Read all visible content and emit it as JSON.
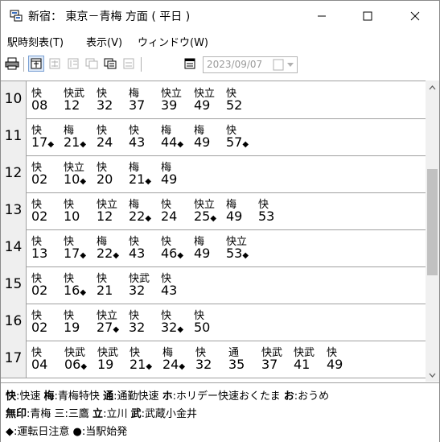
{
  "window": {
    "title": "新宿： 東京－青梅 方面 ( 平日 )"
  },
  "menu": [
    {
      "label": "駅時刻表(T)"
    },
    {
      "label": "表示(V)"
    },
    {
      "label": "ウィンドウ(W)"
    }
  ],
  "toolbar": {
    "date": "2023/09/07",
    "icons": [
      "print-icon",
      "timetable-icon",
      "train-icon",
      "line-icon",
      "weekday-icon",
      "station-icon",
      "holiday-icon",
      "calendar-icon",
      "date-dropdown-icon"
    ]
  },
  "timetable": [
    {
      "hour": "10",
      "entries": [
        {
          "type": "快",
          "min": "08",
          "mark": ""
        },
        {
          "type": "快武",
          "min": "12",
          "mark": ""
        },
        {
          "type": "快",
          "min": "32",
          "mark": ""
        },
        {
          "type": "梅",
          "min": "37",
          "mark": ""
        },
        {
          "type": "快立",
          "min": "39",
          "mark": ""
        },
        {
          "type": "快立",
          "min": "49",
          "mark": ""
        },
        {
          "type": "快",
          "min": "52",
          "mark": ""
        }
      ]
    },
    {
      "hour": "11",
      "entries": [
        {
          "type": "快",
          "min": "17",
          "mark": "◆"
        },
        {
          "type": "梅",
          "min": "21",
          "mark": "◆"
        },
        {
          "type": "快",
          "min": "24",
          "mark": ""
        },
        {
          "type": "快",
          "min": "43",
          "mark": ""
        },
        {
          "type": "梅",
          "min": "44",
          "mark": "◆"
        },
        {
          "type": "梅",
          "min": "49",
          "mark": ""
        },
        {
          "type": "快",
          "min": "57",
          "mark": "◆"
        }
      ]
    },
    {
      "hour": "12",
      "entries": [
        {
          "type": "快",
          "min": "02",
          "mark": ""
        },
        {
          "type": "快立",
          "min": "10",
          "mark": "◆"
        },
        {
          "type": "快",
          "min": "20",
          "mark": ""
        },
        {
          "type": "梅",
          "min": "21",
          "mark": "◆"
        },
        {
          "type": "梅",
          "min": "49",
          "mark": ""
        }
      ]
    },
    {
      "hour": "13",
      "entries": [
        {
          "type": "快",
          "min": "02",
          "mark": ""
        },
        {
          "type": "快",
          "min": "10",
          "mark": ""
        },
        {
          "type": "快立",
          "min": "12",
          "mark": ""
        },
        {
          "type": "梅",
          "min": "22",
          "mark": "◆"
        },
        {
          "type": "快",
          "min": "24",
          "mark": ""
        },
        {
          "type": "快立",
          "min": "25",
          "mark": "◆"
        },
        {
          "type": "梅",
          "min": "49",
          "mark": ""
        },
        {
          "type": "快",
          "min": "53",
          "mark": ""
        }
      ]
    },
    {
      "hour": "14",
      "entries": [
        {
          "type": "快",
          "min": "13",
          "mark": ""
        },
        {
          "type": "快",
          "min": "17",
          "mark": "◆"
        },
        {
          "type": "梅",
          "min": "22",
          "mark": "◆"
        },
        {
          "type": "快",
          "min": "43",
          "mark": ""
        },
        {
          "type": "快",
          "min": "46",
          "mark": "◆"
        },
        {
          "type": "梅",
          "min": "49",
          "mark": ""
        },
        {
          "type": "快立",
          "min": "53",
          "mark": "◆"
        }
      ]
    },
    {
      "hour": "15",
      "entries": [
        {
          "type": "快",
          "min": "02",
          "mark": ""
        },
        {
          "type": "快",
          "min": "16",
          "mark": "◆"
        },
        {
          "type": "快",
          "min": "21",
          "mark": ""
        },
        {
          "type": "快武",
          "min": "32",
          "mark": ""
        },
        {
          "type": "快",
          "min": "43",
          "mark": ""
        }
      ]
    },
    {
      "hour": "16",
      "entries": [
        {
          "type": "快",
          "min": "02",
          "mark": ""
        },
        {
          "type": "快",
          "min": "19",
          "mark": ""
        },
        {
          "type": "快立",
          "min": "27",
          "mark": "◆"
        },
        {
          "type": "快",
          "min": "32",
          "mark": ""
        },
        {
          "type": "快",
          "min": "32",
          "mark": "◆"
        },
        {
          "type": "快",
          "min": "50",
          "mark": ""
        }
      ]
    },
    {
      "hour": "17",
      "entries": [
        {
          "type": "快",
          "min": "04",
          "mark": ""
        },
        {
          "type": "快武",
          "min": "06",
          "mark": "◆"
        },
        {
          "type": "快武",
          "min": "19",
          "mark": ""
        },
        {
          "type": "快",
          "min": "21",
          "mark": "◆"
        },
        {
          "type": "梅",
          "min": "24",
          "mark": "◆"
        },
        {
          "type": "快",
          "min": "32",
          "mark": ""
        },
        {
          "type": "通",
          "min": "35",
          "mark": ""
        },
        {
          "type": "快武",
          "min": "37",
          "mark": ""
        },
        {
          "type": "快武",
          "min": "41",
          "mark": ""
        },
        {
          "type": "快",
          "min": "49",
          "mark": ""
        }
      ]
    }
  ],
  "legend": {
    "line1": [
      {
        "key": "快",
        "text": ":快速 "
      },
      {
        "key": "梅",
        "text": ":青梅特快 "
      },
      {
        "key": "通",
        "text": ":通勤快速 "
      },
      {
        "key": "ホ",
        "text": ":ホリデー快速おくたま "
      },
      {
        "key": "お",
        "text": ":おうめ"
      }
    ],
    "line2": [
      {
        "key": "無印",
        "text": ":青梅 三:三鷹 "
      },
      {
        "key": "立",
        "text": ":立川 "
      },
      {
        "key": "武",
        "text": ":武蔵小金井"
      }
    ],
    "line3": "◆:運転日注意 ●:当駅始発"
  },
  "colors": {
    "border": "#a0a0a0",
    "hour_bg": "#efefef",
    "toolbar_active": "#dde9f8",
    "date_text": "#9a9a9a"
  }
}
